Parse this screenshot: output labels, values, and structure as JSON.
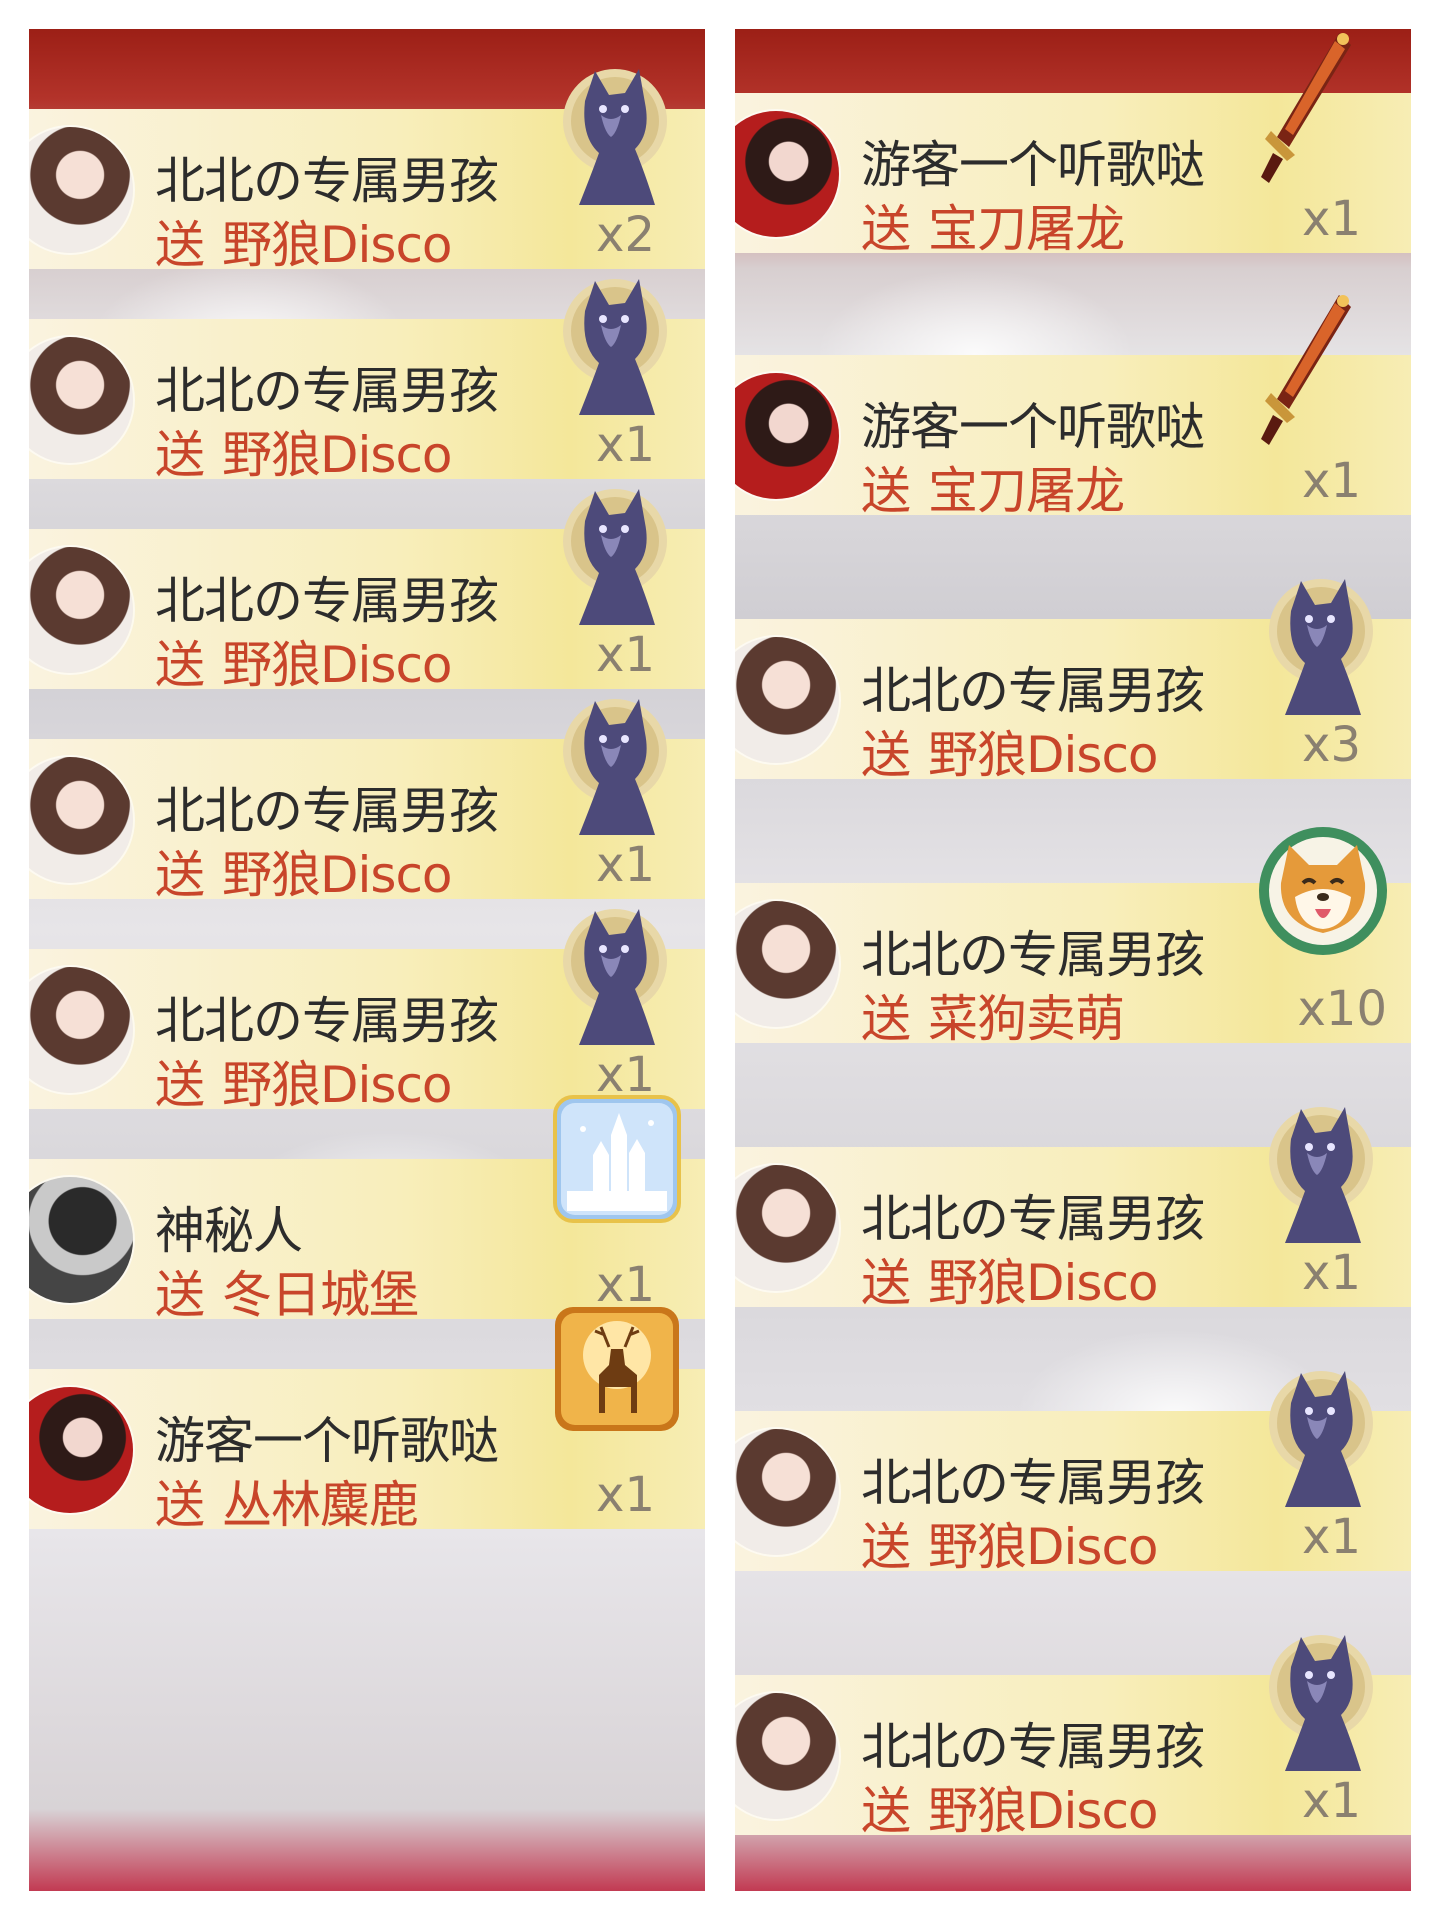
{
  "left_column": [
    {
      "user": "北北の专属男孩",
      "send": "送",
      "gift": "野狼Disco",
      "count": "x2",
      "icon": "wolf-gift-icon",
      "avatar": "woman-avatar"
    },
    {
      "user": "北北の专属男孩",
      "send": "送",
      "gift": "野狼Disco",
      "count": "x1",
      "icon": "wolf-gift-icon",
      "avatar": "woman-avatar"
    },
    {
      "user": "北北の专属男孩",
      "send": "送",
      "gift": "野狼Disco",
      "count": "x1",
      "icon": "wolf-gift-icon",
      "avatar": "woman-avatar"
    },
    {
      "user": "北北の专属男孩",
      "send": "送",
      "gift": "野狼Disco",
      "count": "x1",
      "icon": "wolf-gift-icon",
      "avatar": "woman-avatar"
    },
    {
      "user": "北北の专属男孩",
      "send": "送",
      "gift": "野狼Disco",
      "count": "x1",
      "icon": "wolf-gift-icon",
      "avatar": "woman-avatar"
    },
    {
      "user": "神秘人",
      "send": "送",
      "gift": "冬日城堡",
      "count": "x1",
      "icon": "winter-castle-gift-icon",
      "avatar": "mystery-avatar"
    },
    {
      "user": "游客一个听歌哒",
      "send": "送",
      "gift": "丛林麋鹿",
      "count": "x1",
      "icon": "forest-deer-gift-icon",
      "avatar": "red-dress-avatar"
    }
  ],
  "right_column": [
    {
      "user": "游客一个听歌哒",
      "send": "送",
      "gift": "宝刀屠龙",
      "count": "x1",
      "icon": "dragon-sword-gift-icon",
      "avatar": "red-dress-avatar"
    },
    {
      "user": "游客一个听歌哒",
      "send": "送",
      "gift": "宝刀屠龙",
      "count": "x1",
      "icon": "dragon-sword-gift-icon",
      "avatar": "red-dress-avatar"
    },
    {
      "user": "北北の专属男孩",
      "send": "送",
      "gift": "野狼Disco",
      "count": "x3",
      "icon": "wolf-gift-icon",
      "avatar": "woman-avatar"
    },
    {
      "user": "北北の专属男孩",
      "send": "送",
      "gift": "菜狗卖萌",
      "count": "x10",
      "icon": "shiba-dog-gift-icon",
      "avatar": "woman-avatar"
    },
    {
      "user": "北北の专属男孩",
      "send": "送",
      "gift": "野狼Disco",
      "count": "x1",
      "icon": "wolf-gift-icon",
      "avatar": "woman-avatar"
    },
    {
      "user": "北北の专属男孩",
      "send": "送",
      "gift": "野狼Disco",
      "count": "x1",
      "icon": "wolf-gift-icon",
      "avatar": "woman-avatar"
    },
    {
      "user": "北北の专属男孩",
      "send": "送",
      "gift": "野狼Disco",
      "count": "x1",
      "icon": "wolf-gift-icon",
      "avatar": "woman-avatar"
    }
  ],
  "colors": {
    "row_bg": "#f8eebb",
    "username": "#2c2c2c",
    "gift_text": "#c8452a",
    "count_text": "#8a8070",
    "stream_top": "#9c1f16"
  }
}
